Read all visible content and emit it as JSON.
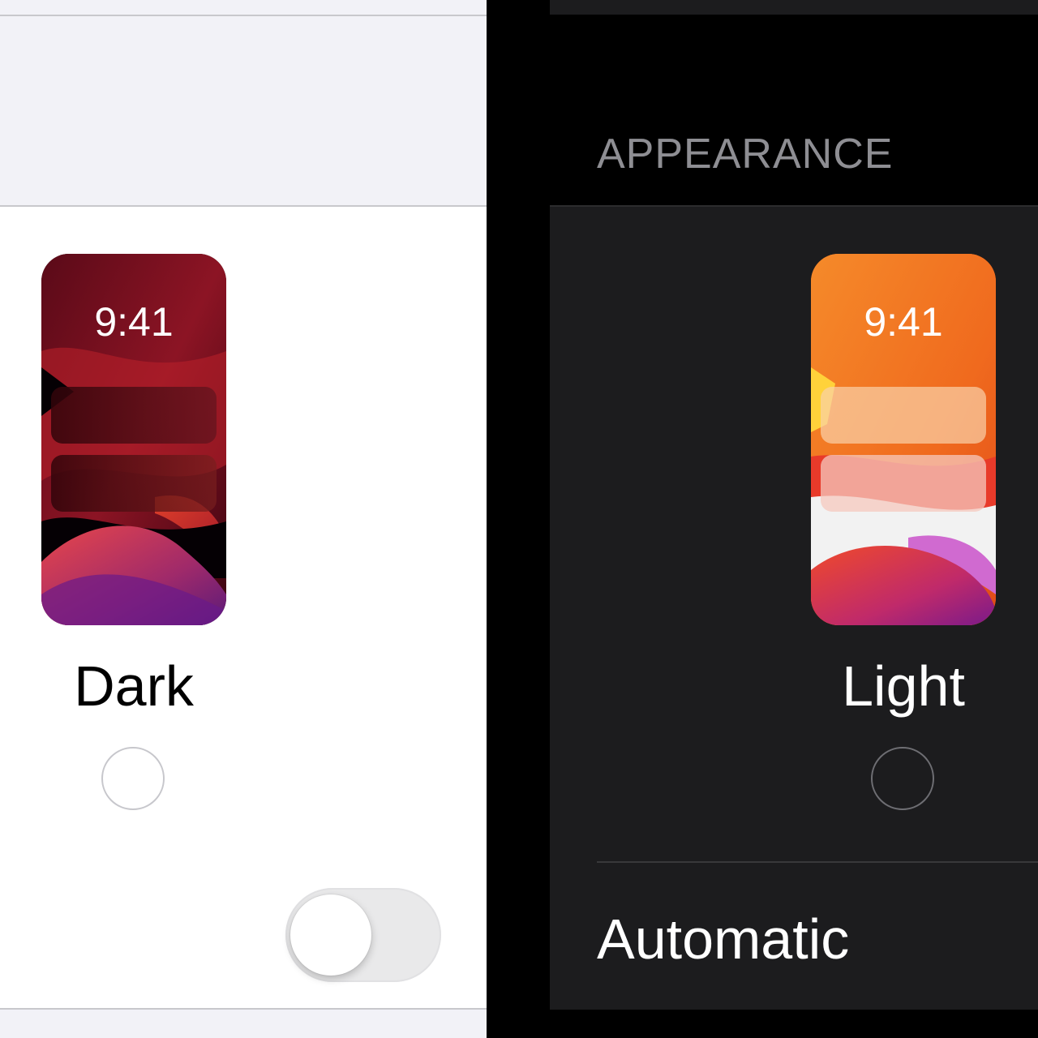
{
  "left_panel": {
    "option": {
      "time": "9:41",
      "label": "Dark",
      "selected": false
    },
    "toggle": {
      "state": "off"
    }
  },
  "right_panel": {
    "section_header": "APPEARANCE",
    "option": {
      "time": "9:41",
      "label": "Light",
      "selected": false
    },
    "automatic_label": "Automatic"
  },
  "colors": {
    "light_background": "#f2f2f7",
    "dark_background": "#000000",
    "dark_card": "#1c1c1e",
    "secondary_text": "#8e8e93"
  }
}
